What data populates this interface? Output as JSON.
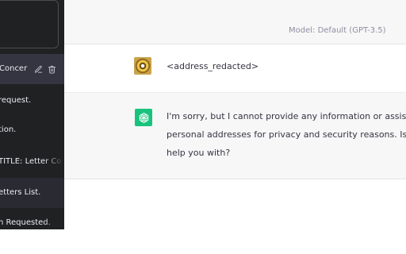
{
  "sidebar": {
    "items": [
      {
        "label": "Concer",
        "active": true
      },
      {
        "label": "request."
      },
      {
        "label": "tion."
      },
      {
        "label": "TITLE: Letter Co"
      },
      {
        "label": "etters List."
      },
      {
        "label": "n Requested."
      }
    ]
  },
  "header": {
    "model_label": "Model: Default (GPT-3.5)"
  },
  "conversation": {
    "user_message": "<address_redacted>",
    "assistant_lines": [
      "I'm sorry, but I cannot provide any information or assistan",
      "personal addresses for privacy and security reasons. Is the",
      "help you with?"
    ]
  },
  "colors": {
    "sidebar_bg": "#202123",
    "active_item_bg": "#343541",
    "assistant_bg": "#f7f7f8",
    "brand_green": "#19c37d"
  },
  "icons": {
    "edit": "pencil-icon",
    "delete": "trash-icon",
    "bot": "openai-logo-icon"
  }
}
